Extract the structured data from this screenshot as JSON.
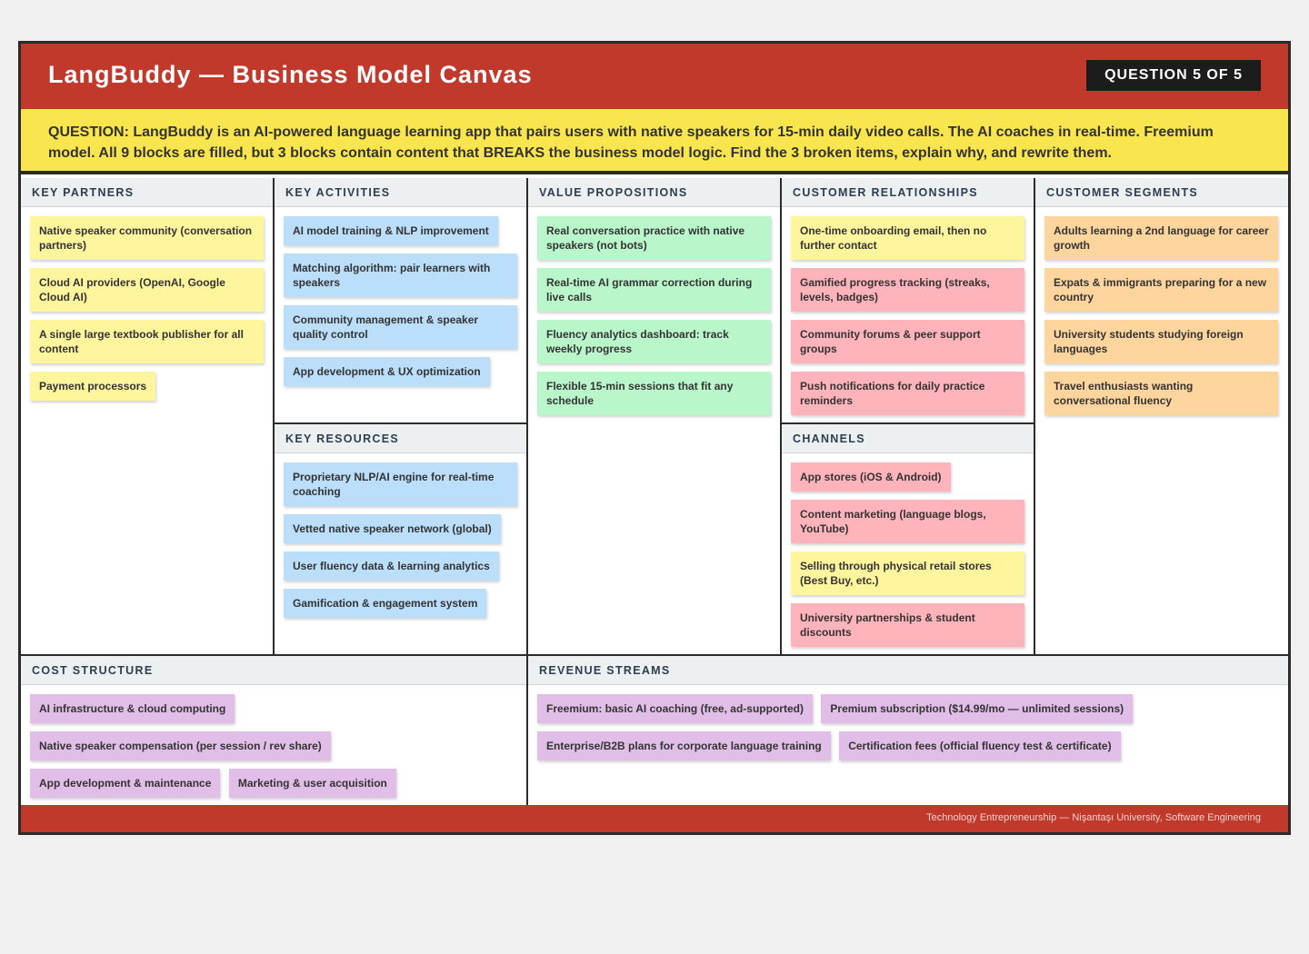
{
  "header": {
    "title": "LangBuddy — Business Model Canvas",
    "question_badge": "QUESTION 5 OF 5"
  },
  "question": "QUESTION: LangBuddy is an AI-powered language learning app that pairs users with native speakers for 15-min daily video calls. The AI coaches in real-time. Freemium model. All 9 blocks are filled, but 3 blocks contain content that BREAKS the business model logic. Find the 3 broken items, explain why, and rewrite them.",
  "key_partners": {
    "title": "KEY PARTNERS",
    "items": [
      "Native speaker community (conversation partners)",
      "Cloud AI providers (OpenAI, Google Cloud AI)",
      "A single large textbook publisher for all content",
      "Payment processors"
    ]
  },
  "key_activities": {
    "title": "KEY ACTIVITIES",
    "items": [
      "AI model training & NLP improvement",
      "Matching algorithm: pair learners with speakers",
      "Community management & speaker quality control",
      "App development & UX optimization"
    ]
  },
  "key_resources": {
    "title": "KEY RESOURCES",
    "items": [
      "Proprietary NLP/AI engine for real-time coaching",
      "Vetted native speaker network (global)",
      "User fluency data & learning analytics",
      "Gamification & engagement system"
    ]
  },
  "value_propositions": {
    "title": "VALUE PROPOSITIONS",
    "items": [
      "Real conversation practice with native speakers (not bots)",
      "Real-time AI grammar correction during live calls",
      "Fluency analytics dashboard: track weekly progress",
      "Flexible 15-min sessions that fit any schedule"
    ]
  },
  "customer_relationships": {
    "title": "CUSTOMER RELATIONSHIPS",
    "items": [
      "One-time onboarding email, then no further contact",
      "Gamified progress tracking (streaks, levels, badges)",
      "Community forums & peer support groups",
      "Push notifications for daily practice reminders"
    ]
  },
  "channels": {
    "title": "CHANNELS",
    "items": [
      "App stores (iOS & Android)",
      "Content marketing (language blogs, YouTube)",
      "Selling through physical retail stores (Best Buy, etc.)",
      "University partnerships & student discounts"
    ]
  },
  "customer_segments": {
    "title": "CUSTOMER SEGMENTS",
    "items": [
      "Adults learning a 2nd language for career growth",
      "Expats & immigrants preparing for a new country",
      "University students studying foreign languages",
      "Travel enthusiasts wanting conversational fluency"
    ]
  },
  "cost_structure": {
    "title": "COST STRUCTURE",
    "items": [
      "AI infrastructure & cloud computing",
      "Native speaker compensation (per session / rev share)",
      "App development & maintenance",
      "Marketing & user acquisition"
    ]
  },
  "revenue_streams": {
    "title": "REVENUE STREAMS",
    "items": [
      "Freemium: basic AI coaching (free, ad-supported)",
      "Premium subscription ($14.99/mo — unlimited sessions)",
      "Enterprise/B2B plans for corporate language training",
      "Certification fees (official fluency test & certificate)"
    ]
  },
  "footer": "Technology Entrepreneurship — Nişantaşı University, Software Engineering",
  "colors": {
    "header_red": "#c0392b",
    "question_yellow": "#f9e64f",
    "note_yellow": "#fff59d",
    "note_blue": "#bbdefb",
    "note_green": "#b9f6ca",
    "note_pink": "#ffb3ba",
    "note_orange": "#ffd59e",
    "note_purple": "#e1bee7"
  }
}
